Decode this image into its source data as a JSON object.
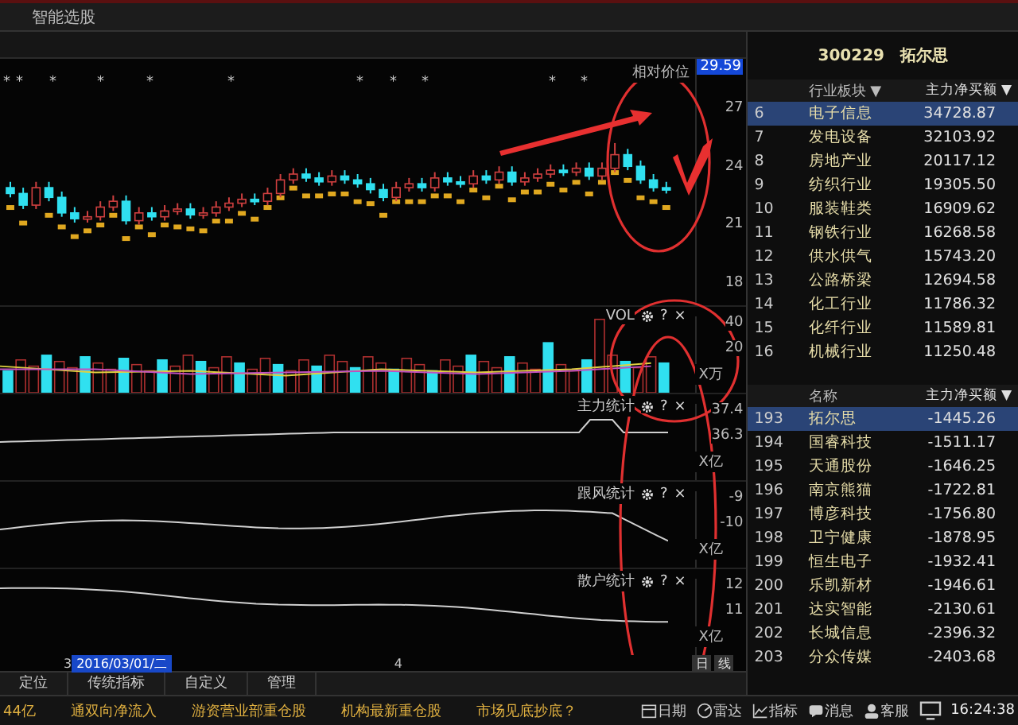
{
  "top_menu": {
    "label": "智能选股"
  },
  "price_panel": {
    "label": "相对价位",
    "price_badge": "29.59",
    "markers": [
      "*",
      "*",
      "*",
      "*",
      "*",
      "*",
      "*",
      "*",
      "*",
      "*",
      "*"
    ],
    "chart_data": {
      "type": "candlestick",
      "ylim": [
        16.84,
        29.54
      ],
      "yticks": [
        27,
        24,
        21,
        18
      ],
      "ohlc": [
        [
          22.9,
          23.2,
          22.4,
          22.6
        ],
        [
          22.6,
          22.9,
          21.8,
          22.0
        ],
        [
          22.0,
          23.2,
          21.8,
          22.9
        ],
        [
          22.9,
          23.2,
          22.2,
          22.4
        ],
        [
          22.4,
          22.7,
          21.4,
          21.6
        ],
        [
          21.6,
          21.9,
          21.1,
          21.3
        ],
        [
          21.3,
          21.7,
          21.1,
          21.4
        ],
        [
          21.4,
          22.2,
          21.2,
          21.9
        ],
        [
          21.9,
          22.5,
          21.7,
          22.2
        ],
        [
          22.2,
          22.5,
          21.0,
          21.2
        ],
        [
          21.2,
          21.9,
          21.0,
          21.6
        ],
        [
          21.6,
          21.9,
          21.2,
          21.4
        ],
        [
          21.4,
          22.0,
          21.2,
          21.7
        ],
        [
          21.7,
          22.1,
          21.5,
          21.8
        ],
        [
          21.8,
          22.1,
          21.3,
          21.5
        ],
        [
          21.5,
          21.9,
          21.3,
          21.6
        ],
        [
          21.6,
          22.2,
          21.4,
          21.9
        ],
        [
          21.9,
          22.4,
          21.7,
          22.1
        ],
        [
          22.1,
          22.6,
          21.9,
          22.3
        ],
        [
          22.3,
          22.6,
          22.0,
          22.2
        ],
        [
          22.2,
          22.9,
          22.0,
          22.6
        ],
        [
          22.6,
          23.6,
          22.4,
          23.3
        ],
        [
          23.3,
          23.9,
          23.1,
          23.6
        ],
        [
          23.6,
          23.9,
          23.2,
          23.4
        ],
        [
          23.4,
          23.7,
          23.0,
          23.2
        ],
        [
          23.2,
          23.8,
          23.0,
          23.5
        ],
        [
          23.5,
          23.8,
          23.1,
          23.3
        ],
        [
          23.3,
          23.6,
          22.9,
          23.1
        ],
        [
          23.1,
          23.4,
          22.6,
          22.8
        ],
        [
          22.8,
          23.1,
          22.2,
          22.4
        ],
        [
          22.4,
          23.2,
          22.2,
          22.9
        ],
        [
          22.9,
          23.4,
          22.7,
          23.1
        ],
        [
          23.1,
          23.4,
          22.7,
          22.9
        ],
        [
          22.9,
          23.7,
          22.7,
          23.4
        ],
        [
          23.4,
          23.7,
          23.0,
          23.2
        ],
        [
          23.2,
          23.5,
          22.9,
          23.1
        ],
        [
          23.1,
          23.8,
          22.9,
          23.5
        ],
        [
          23.5,
          23.8,
          23.1,
          23.3
        ],
        [
          23.3,
          24.0,
          23.1,
          23.7
        ],
        [
          23.7,
          24.0,
          23.0,
          23.2
        ],
        [
          23.2,
          23.7,
          23.0,
          23.4
        ],
        [
          23.4,
          23.9,
          23.2,
          23.6
        ],
        [
          23.6,
          24.1,
          23.4,
          23.8
        ],
        [
          23.8,
          24.1,
          23.5,
          23.7
        ],
        [
          23.7,
          24.2,
          23.5,
          23.9
        ],
        [
          23.9,
          24.2,
          23.3,
          23.5
        ],
        [
          23.5,
          24.2,
          23.3,
          23.9
        ],
        [
          23.9,
          25.2,
          23.7,
          24.6
        ],
        [
          24.6,
          24.9,
          23.8,
          24.0
        ],
        [
          24.0,
          24.3,
          23.1,
          23.3
        ],
        [
          23.3,
          23.6,
          22.7,
          22.9
        ],
        [
          22.9,
          23.2,
          22.6,
          22.8
        ]
      ]
    }
  },
  "indicator_panels": [
    {
      "kind": "bars",
      "title": "VOL",
      "help": "?",
      "close": "×",
      "ticks": [
        "40",
        "20"
      ],
      "unit": "X万"
    },
    {
      "kind": "line",
      "title": "主力统计",
      "help": "?",
      "close": "×",
      "ticks": [
        "37.4",
        "36.3"
      ],
      "unit": "X亿"
    },
    {
      "kind": "line",
      "title": "跟风统计",
      "help": "?",
      "close": "×",
      "ticks": [
        "-9",
        "-10"
      ],
      "unit": "X亿"
    },
    {
      "kind": "line",
      "title": "散户统计",
      "help": "?",
      "close": "×",
      "ticks": [
        "12",
        "11"
      ],
      "unit": "X亿"
    }
  ],
  "x_axis": {
    "labels": [
      "3",
      "4"
    ],
    "cursor_date": "2016/03/01/二"
  },
  "chart_buttons": [
    "日",
    "线"
  ],
  "bottom_tabs": [
    {
      "label": "定位",
      "selected": false
    },
    {
      "label": "传统指标",
      "selected": false
    },
    {
      "label": "自定义",
      "selected": false
    },
    {
      "label": "管理",
      "selected": false
    }
  ],
  "stock_title": {
    "code": "300229",
    "name": "拓尔思"
  },
  "industry_table": {
    "columns": [
      "行业板块 ▼",
      "主力净买额 ▼"
    ],
    "rows": [
      {
        "rank": "6",
        "name": "电子信息",
        "value": "34728.87",
        "selected": true
      },
      {
        "rank": "7",
        "name": "发电设备",
        "value": "32103.92",
        "selected": false
      },
      {
        "rank": "8",
        "name": "房地产业",
        "value": "20117.12",
        "selected": false
      },
      {
        "rank": "9",
        "name": "纺织行业",
        "value": "19305.50",
        "selected": false
      },
      {
        "rank": "10",
        "name": "服装鞋类",
        "value": "16909.62",
        "selected": false
      },
      {
        "rank": "11",
        "name": "钢铁行业",
        "value": "16268.58",
        "selected": false
      },
      {
        "rank": "12",
        "name": "供水供气",
        "value": "15743.20",
        "selected": false
      },
      {
        "rank": "13",
        "name": "公路桥梁",
        "value": "12694.58",
        "selected": false
      },
      {
        "rank": "14",
        "name": "化工行业",
        "value": "11786.32",
        "selected": false
      },
      {
        "rank": "15",
        "name": "化纤行业",
        "value": "11589.81",
        "selected": false
      },
      {
        "rank": "16",
        "name": "机械行业",
        "value": "11250.48",
        "selected": false
      }
    ]
  },
  "stock_table": {
    "columns": [
      "名称",
      "主力净买额 ▼"
    ],
    "rows": [
      {
        "rank": "193",
        "name": "拓尔思",
        "value": "-1445.26",
        "selected": true
      },
      {
        "rank": "194",
        "name": "国睿科技",
        "value": "-1511.17",
        "selected": false
      },
      {
        "rank": "195",
        "name": "天通股份",
        "value": "-1646.25",
        "selected": false
      },
      {
        "rank": "196",
        "name": "南京熊猫",
        "value": "-1722.81",
        "selected": false
      },
      {
        "rank": "197",
        "name": "博彦科技",
        "value": "-1756.80",
        "selected": false
      },
      {
        "rank": "198",
        "name": "卫宁健康",
        "value": "-1878.95",
        "selected": false
      },
      {
        "rank": "199",
        "name": "恒生电子",
        "value": "-1932.41",
        "selected": false
      },
      {
        "rank": "200",
        "name": "乐凯新材",
        "value": "-1946.61",
        "selected": false
      },
      {
        "rank": "201",
        "name": "达实智能",
        "value": "-2130.61",
        "selected": false
      },
      {
        "rank": "202",
        "name": "长城信息",
        "value": "-2396.32",
        "selected": false
      },
      {
        "rank": "203",
        "name": "分众传媒",
        "value": "-2403.68",
        "selected": false
      }
    ]
  },
  "status_bar": {
    "ticker": [
      "44亿",
      "通双向净流入",
      "游资营业部重仓股",
      "机构最新重仓股",
      "市场见底抄底？"
    ],
    "tools": [
      {
        "kind": "calendar",
        "label": "日期"
      },
      {
        "kind": "radar",
        "label": "雷达"
      },
      {
        "kind": "chart",
        "label": "指标"
      },
      {
        "kind": "message",
        "label": "消息"
      },
      {
        "kind": "service",
        "label": "客服"
      }
    ],
    "time": "16:24:38"
  }
}
